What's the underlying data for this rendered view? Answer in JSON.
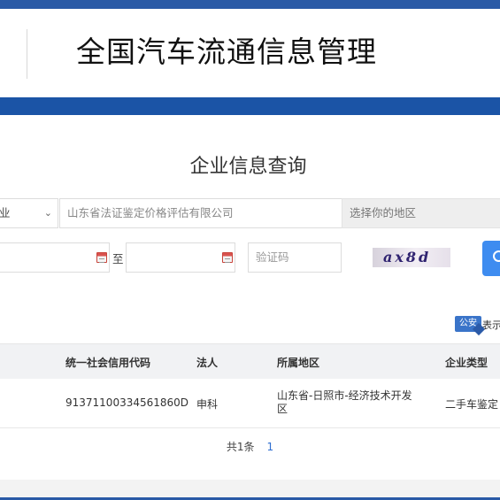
{
  "header": {
    "site_title": "全国汽车流通信息管理"
  },
  "query": {
    "title": "企业信息查询",
    "type_select_value": "业",
    "company_value": "山东省法证鉴定价格评估有限公司",
    "region_placeholder": "选择你的地区",
    "date_separator": "至",
    "captcha_placeholder": "验证码",
    "captcha_text": "ax8d"
  },
  "notice": {
    "badge_text": "公安",
    "badge_label": "表示"
  },
  "table": {
    "columns": [
      "统一社会信用代码",
      "法人",
      "所属地区",
      "企业类型"
    ],
    "rows": [
      {
        "credit_code": "91371100334561860D",
        "legal_person": "申科",
        "region": "山东省-日照市-经济技术开发区",
        "type": "二手车鉴定"
      }
    ]
  },
  "pagination": {
    "total_text": "共1条",
    "current_page": "1"
  },
  "colors": {
    "brand_blue": "#1b54a6",
    "accent_blue": "#3e8cf0",
    "link_blue": "#2f6fd1"
  }
}
